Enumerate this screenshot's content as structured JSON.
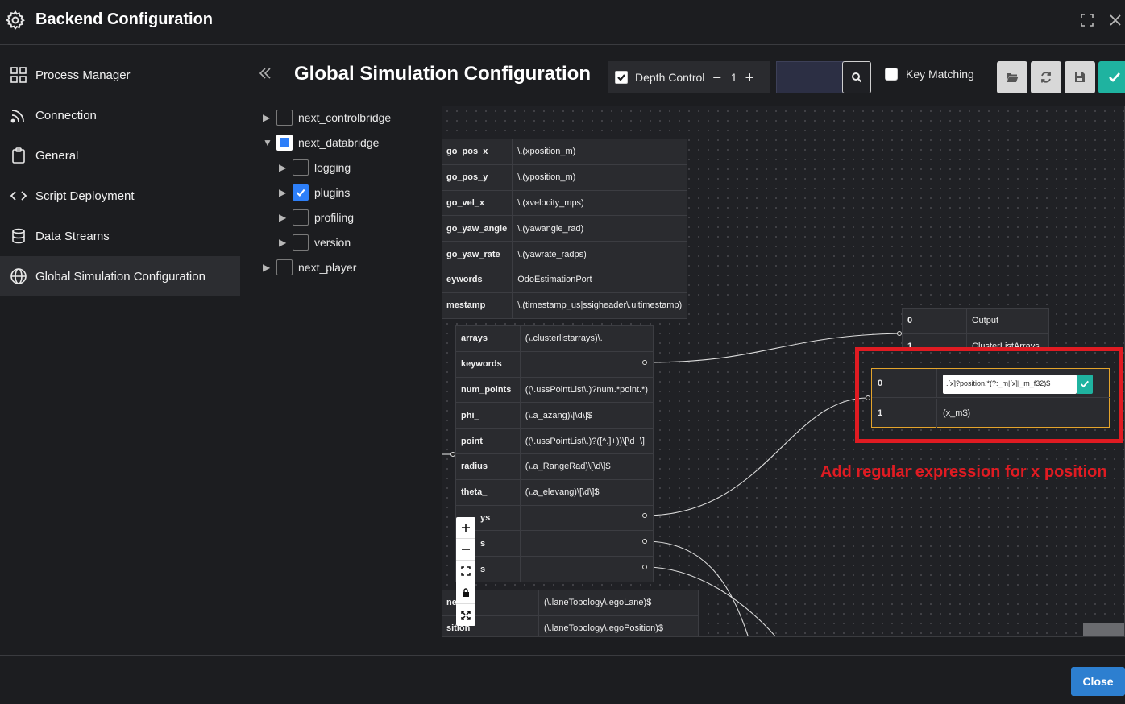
{
  "window": {
    "title": "Backend Configuration"
  },
  "sidebar": {
    "items": [
      {
        "label": "Process Manager",
        "icon": "grid-icon"
      },
      {
        "label": "Connection",
        "icon": "signal-icon"
      },
      {
        "label": "General",
        "icon": "clipboard-icon"
      },
      {
        "label": "Script Deployment",
        "icon": "code-icon"
      },
      {
        "label": "Data Streams",
        "icon": "database-icon"
      },
      {
        "label": "Global Simulation Configuration",
        "icon": "globe-icon",
        "active": true
      }
    ]
  },
  "main": {
    "title": "Global Simulation Configuration",
    "toolbar": {
      "depth_label": "Depth Control",
      "depth_value": "1",
      "key_matching_label": "Key Matching"
    },
    "tree": [
      {
        "label": "next_controlbridge",
        "level": 0,
        "expanded": false,
        "state": "unchecked"
      },
      {
        "label": "next_databridge",
        "level": 0,
        "expanded": true,
        "state": "partial"
      },
      {
        "label": "logging",
        "level": 1,
        "expanded": false,
        "state": "unchecked"
      },
      {
        "label": "plugins",
        "level": 1,
        "expanded": false,
        "state": "checked"
      },
      {
        "label": "profiling",
        "level": 1,
        "expanded": false,
        "state": "unchecked"
      },
      {
        "label": "version",
        "level": 1,
        "expanded": false,
        "state": "unchecked"
      },
      {
        "label": "next_player",
        "level": 0,
        "expanded": false,
        "state": "unchecked"
      }
    ]
  },
  "graph": {
    "node_ego": [
      [
        "go_pos_x",
        "\\.(xposition_m)"
      ],
      [
        "go_pos_y",
        "\\.(yposition_m)"
      ],
      [
        "go_vel_x",
        "\\.(xvelocity_mps)"
      ],
      [
        "go_yaw_angle",
        "\\.(yawangle_rad)"
      ],
      [
        "go_yaw_rate",
        "\\.(yawrate_radps)"
      ],
      [
        "eywords",
        "OdoEstimationPort"
      ],
      [
        "mestamp",
        "\\.(timestamp_us|ssigheader\\.uitimestamp)"
      ]
    ],
    "node_cluster": [
      [
        "arrays",
        "(\\.clusterlistarrays)\\."
      ],
      [
        "keywords",
        ""
      ],
      [
        "num_points",
        "((\\.ussPointList\\.)?num.*point.*)"
      ],
      [
        "phi_",
        "(\\.a_azang)\\[\\d\\]$"
      ],
      [
        "point_",
        "((\\.ussPointList\\.)?([^.]+))\\[\\d+\\]"
      ],
      [
        "radius_",
        "(\\.a_RangeRad)\\[\\d\\]$"
      ],
      [
        "theta_",
        "(\\.a_elevang)\\[\\d\\]$"
      ],
      [
        "ys",
        ""
      ],
      [
        "s",
        ""
      ],
      [
        "s",
        ""
      ]
    ],
    "node_lane": [
      [
        "ne_",
        "(\\.laneTopology\\.egoLane)$"
      ],
      [
        "sition_",
        "(\\.laneTopology\\.egoPosition)$"
      ]
    ],
    "node_output": [
      [
        "0",
        "Output"
      ],
      [
        "1",
        "ClusterListArrays"
      ]
    ],
    "node_edit": {
      "row0_key": "0",
      "row0_value": ".[x]?position.*(?:_m|[x]|_m_f32)$",
      "row1_key": "1",
      "row1_value": "(x_m$)"
    }
  },
  "annotation": {
    "text": "Add regular expression for x position",
    "color": "#e01b22"
  },
  "footer": {
    "close_label": "Close"
  },
  "colors": {
    "accent_green": "#1fb3a0",
    "accent_blue": "#2d7fd0",
    "highlight_orange": "#e4a42c"
  }
}
